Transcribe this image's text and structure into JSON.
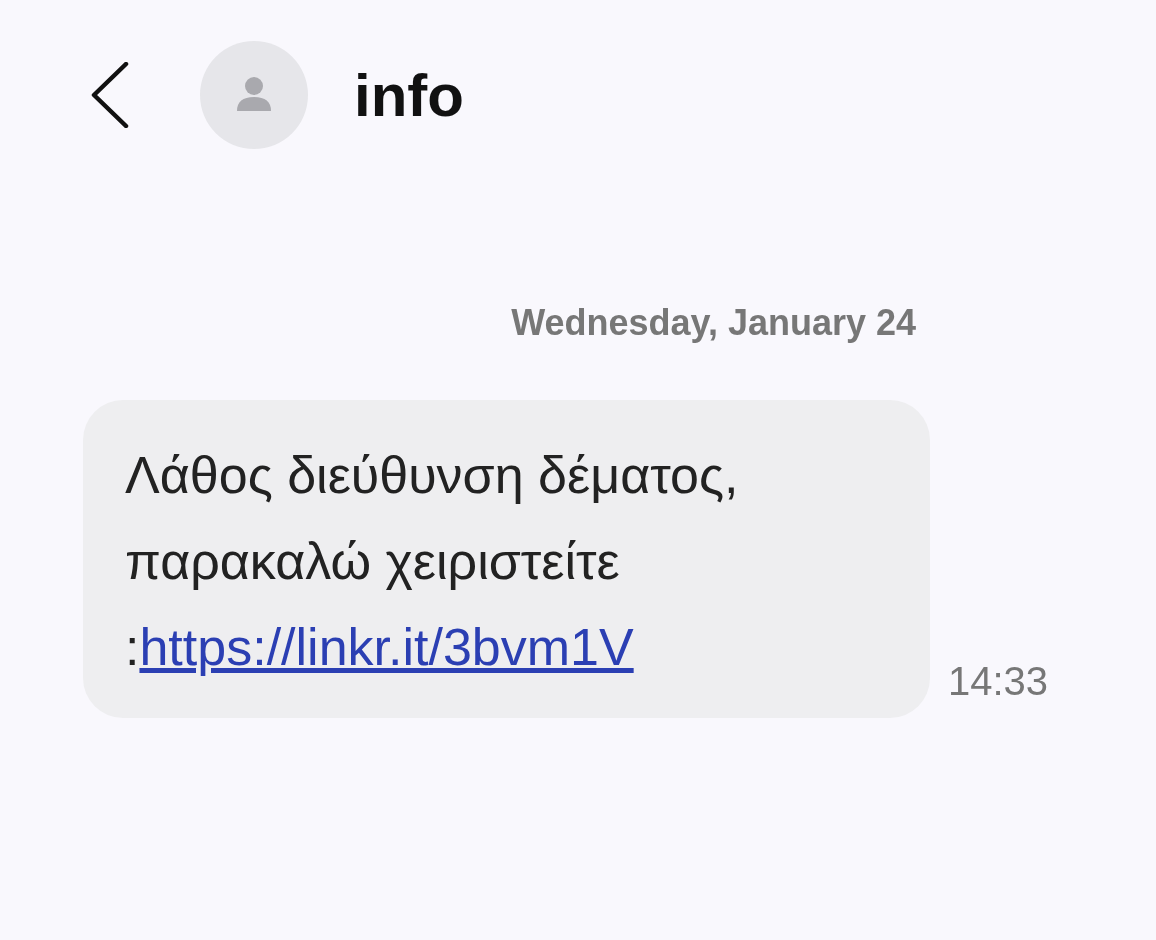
{
  "header": {
    "title": "info"
  },
  "date_divider": "Wednesday, January 24",
  "messages": [
    {
      "text": "Λάθος διεύθυνση δέματος, παρακαλώ χειριστείτε :",
      "link": "https://linkr.it/3bvm1V",
      "time": "14:33"
    }
  ]
}
